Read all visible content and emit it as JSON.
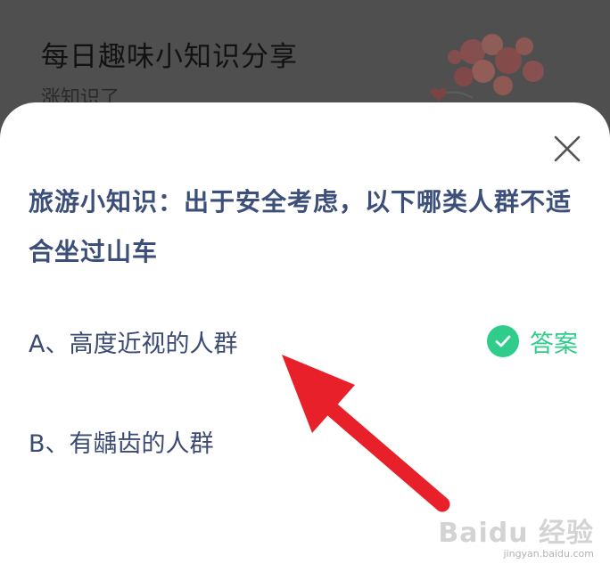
{
  "background": {
    "title": "每日趣味小知识分享",
    "subtitle": "涨知识了"
  },
  "question": {
    "text": "旅游小知识：出于安全考虑，以下哪类人群不适合坐过山车"
  },
  "options": [
    {
      "label": "A、高度近视的人群"
    },
    {
      "label": "B、有龋齿的人群"
    }
  ],
  "answer": {
    "label": "答案",
    "color": "#2fcc8b"
  },
  "colors": {
    "question_text": "#3c4f7a",
    "option_text": "#3a4a72",
    "arrow": "#e8202a"
  },
  "watermark": {
    "logo": "Baidu 经验",
    "url": "jingyan.baidu.com"
  }
}
